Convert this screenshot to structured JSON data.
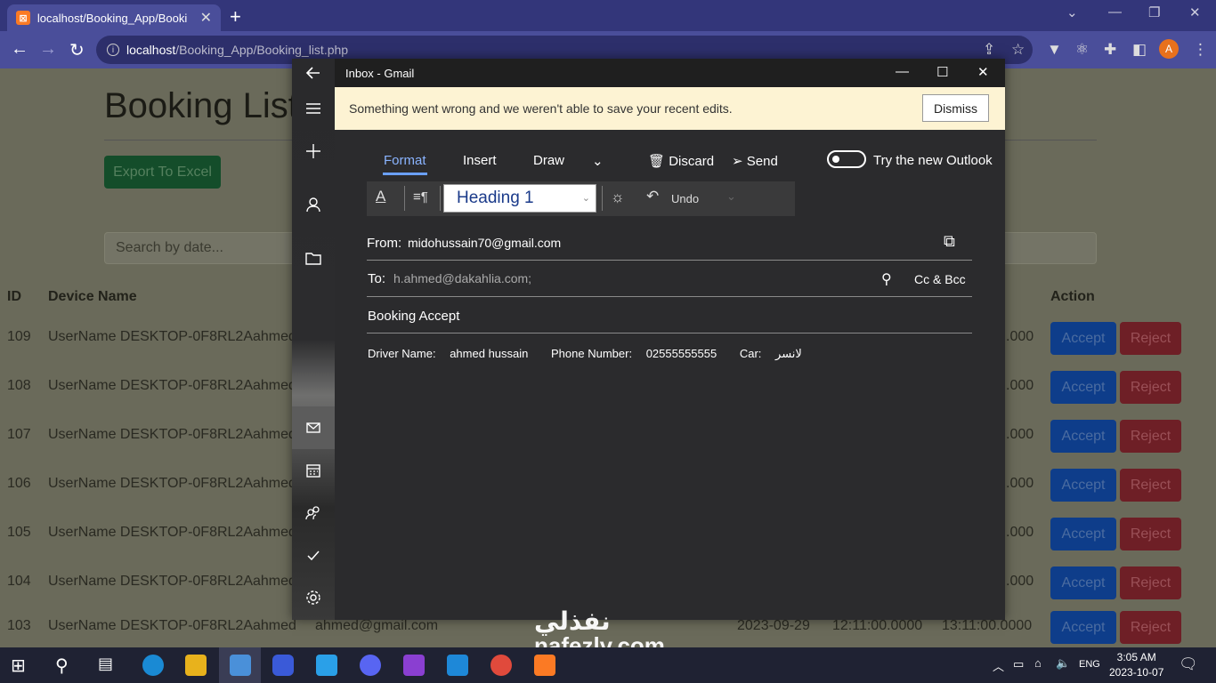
{
  "browser": {
    "tab_title": "localhost/Booking_App/Booking",
    "url_host": "localhost",
    "url_path": "/Booking_App/Booking_list.php"
  },
  "page": {
    "title": "Booking List",
    "export_label": "Export To Excel",
    "search_placeholder": "Search by date...",
    "columns": {
      "id": "ID",
      "device": "Device Name",
      "action": "Action"
    },
    "rows": [
      {
        "id": "109",
        "device": "UserName DESKTOP-0F8RL2Aahmed",
        "tail": ".000"
      },
      {
        "id": "108",
        "device": "UserName DESKTOP-0F8RL2Aahmed",
        "tail": ".000"
      },
      {
        "id": "107",
        "device": "UserName DESKTOP-0F8RL2Aahmed",
        "tail": ".000"
      },
      {
        "id": "106",
        "device": "UserName DESKTOP-0F8RL2Aahmed",
        "tail": ".000"
      },
      {
        "id": "105",
        "device": "UserName DESKTOP-0F8RL2Aahmed",
        "tail": ".000"
      },
      {
        "id": "104",
        "device": "UserName DESKTOP-0F8RL2Aahmed",
        "tail": ".000"
      }
    ],
    "last_row": {
      "id": "103",
      "device": "UserName DESKTOP-0F8RL2Aahmed",
      "email": "ahmed@gmail.com",
      "date": "2023-09-29",
      "time1": "12:11:00.0000",
      "time2": "13:11:00.0000"
    },
    "accept_label": "Accept",
    "reject_label": "Reject"
  },
  "mail": {
    "window_title": "Inbox - Gmail",
    "banner_message": "Something went wrong and we weren't able to save your recent edits.",
    "dismiss_label": "Dismiss",
    "tabs": {
      "format": "Format",
      "insert": "Insert",
      "draw": "Draw"
    },
    "discard_label": "Discard",
    "send_label": "Send",
    "try_outlook_label": "Try the new Outlook",
    "heading_value": "Heading 1",
    "undo_label": "Undo",
    "from_label": "From:",
    "from_value": "midohussain70@gmail.com",
    "to_label": "To:",
    "to_value": "h.ahmed@dakahlia.com;",
    "ccbcc_label": "Cc & Bcc",
    "subject": "Booking Accept",
    "body": {
      "driver_label": "Driver Name:",
      "driver_value": "ahmed hussain",
      "phone_label": "Phone Number:",
      "phone_value": "02555555555",
      "car_label": "Car:",
      "car_value": "لانسر"
    }
  },
  "watermark": {
    "line1": "نفذلي",
    "line2": "nafezly.com"
  },
  "taskbar": {
    "lang": "ENG",
    "time": "3:05 AM",
    "date": "2023-10-07"
  }
}
